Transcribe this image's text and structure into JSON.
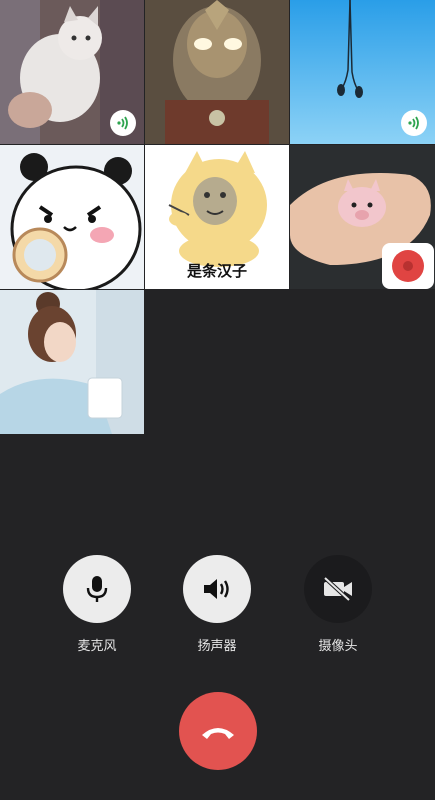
{
  "participants": [
    {
      "name_icon": "cat-photo",
      "speaking": true
    },
    {
      "name_icon": "ultraman-photo",
      "speaking": false
    },
    {
      "name_icon": "earphones-photo",
      "speaking": true
    },
    {
      "name_icon": "panda-sticker",
      "speaking": false
    },
    {
      "name_icon": "doge-meme",
      "speaking": false,
      "caption": "是条汉子"
    },
    {
      "name_icon": "pig-toy-photo",
      "speaking": false
    },
    {
      "name_icon": "woman-photo",
      "speaking": false
    }
  ],
  "controls": {
    "microphone_label": "麦克风",
    "speaker_label": "扬声器",
    "camera_label": "摄像头"
  },
  "colors": {
    "background": "#232325",
    "hangup": "#e25350",
    "speaking_indicator": "#2ea44f"
  }
}
